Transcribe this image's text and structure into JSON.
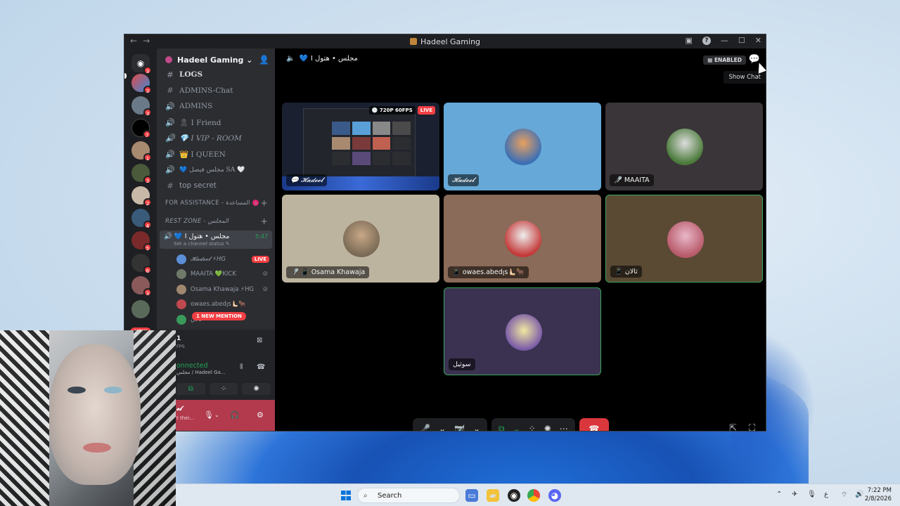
{
  "window": {
    "title": "Hadeel Gaming",
    "back_glyph": "←",
    "fwd_glyph": "→",
    "minimize": "—",
    "maximize": "☐",
    "close": "✕",
    "help": "?"
  },
  "rail": {
    "badges": [
      "3",
      "3",
      "3",
      "7",
      "1",
      "3",
      "2",
      "4",
      "5",
      "6",
      "3"
    ],
    "new_label": "NEW"
  },
  "sidebar": {
    "server_name": "Hadeel Gaming ⌄",
    "channels": [
      {
        "icon": "#",
        "label": "LOGS",
        "bold": true
      },
      {
        "icon": "#",
        "label": "ADMINS-Chat"
      },
      {
        "icon": "🔊",
        "label": "ADMINS"
      },
      {
        "icon": "🔊",
        "label": "🎗 I Friend"
      },
      {
        "icon": "🔊",
        "label": "💎 I VIP - ROOM"
      },
      {
        "icon": "🔊",
        "label": "👑 I QUEEN"
      },
      {
        "icon": "🔊",
        "label": "💙 مجلس فيصل SA 🤍"
      },
      {
        "icon": "#",
        "label": "top secret"
      }
    ],
    "categories": {
      "assistance": "FOR ASSISTANCE - المساعدة",
      "rest_zone": "REST ZONE - المجلس"
    },
    "active_channel": {
      "label": "💙 I مجلس • هتول",
      "time": "5:47",
      "status": "Set a channel status ✎"
    },
    "voice_users": [
      {
        "name": "𝓗𝓪𝓭𝓮𝓮𝓵 ⚡HG",
        "live": "LIVE",
        "color": "#5b8fd8"
      },
      {
        "name": "MAAITA 💚KICK",
        "color": "#6f7a6a"
      },
      {
        "name": "Osama Khawaja ⚡HG",
        "color": "#a08870"
      },
      {
        "name": "owaes.abedןs🫷🏻🐂",
        "color": "#c0484f"
      },
      {
        "name": "ثالان",
        "color": "#3a9a5a"
      }
    ],
    "mention": "1 NEW MENTION",
    "status": {
      "stream_label": "1",
      "fps": "FPS",
      "connected": "onnected",
      "location": "مجلس / Hadeel Ga...",
      "user_name": "𝓮𝓵",
      "user_status": "t thei..."
    }
  },
  "voice": {
    "header": "I مجلس • هتول",
    "enabled_label": "ENABLED",
    "tooltip": "Show Chat",
    "tiles": [
      {
        "name": "💬 𝓗𝓪𝓭𝓮𝓮𝓵",
        "quality": "🕒 720P 60FPS",
        "live": "LIVE",
        "bg": "#1a2030",
        "type": "stream"
      },
      {
        "name": "𝓗𝓪𝓭𝓮𝓮𝓵",
        "bg": "#66a9d8",
        "ava": "#3c6fb5"
      },
      {
        "name": "🎤̸ MAAITA",
        "bg": "#3a3538",
        "ava": "#4a7a3a"
      },
      {
        "name": "🎤̸ 📱 Osama Khawaja",
        "bg": "#bdb49f",
        "ava": "#7a6a55"
      },
      {
        "name": "📱 owaes.abedןs🫷🏻🐂",
        "bg": "#8a6a58",
        "ava": "#c43a3a"
      },
      {
        "name": "📱 ثالان",
        "bg": "#5a4a34",
        "ava": "#b85a6a",
        "speaking": true
      },
      {
        "name": "سوثيل",
        "bg": "#3a3250",
        "ava": "#e8dc8a",
        "speaking": true
      }
    ],
    "controls": {
      "mic": "🎤",
      "chev": "⌄",
      "cam": "📷̸",
      "share": "⧉",
      "activity": "⁘",
      "soundboard": "✺",
      "more": "⋯",
      "end": "☎"
    },
    "popout": "⇱",
    "fullscreen": "⛶"
  },
  "taskbar": {
    "search": "Search",
    "time": "7:22 PM",
    "date": "2/8/2026",
    "lang": "ع"
  }
}
